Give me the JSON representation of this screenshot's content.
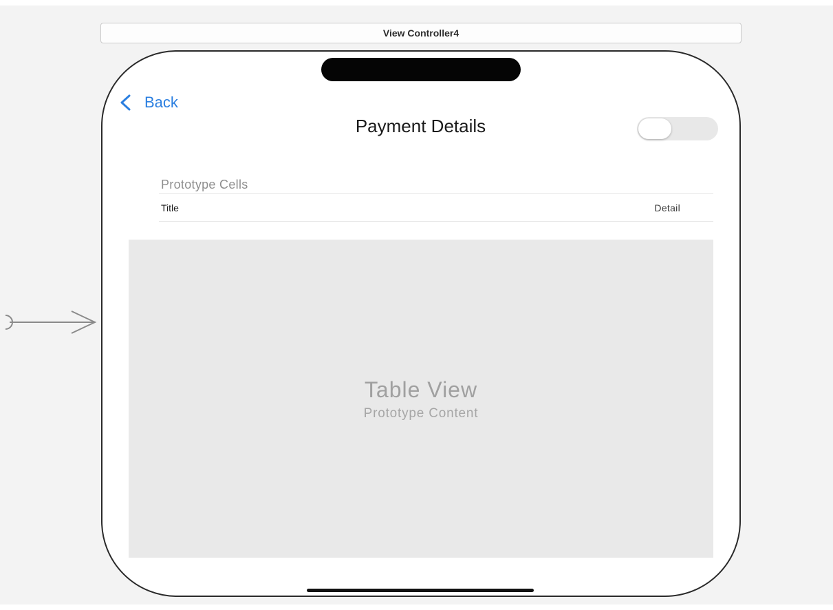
{
  "scene": {
    "title": "View Controller4"
  },
  "nav": {
    "back_label": "Back",
    "title": "Payment Details",
    "toggle_on": false
  },
  "table": {
    "section_header": "Prototype Cells",
    "prototype_cell": {
      "title": "Title",
      "detail": "Detail"
    },
    "placeholder_title": "Table View",
    "placeholder_subtitle": "Prototype Content"
  },
  "colors": {
    "accent": "#2b7fe0",
    "canvas": "#f3f3f3",
    "table_background": "#e9e9e9"
  },
  "icons": {
    "back": "chevron-left-icon",
    "entry_point": "entry-point-arrow-icon"
  }
}
